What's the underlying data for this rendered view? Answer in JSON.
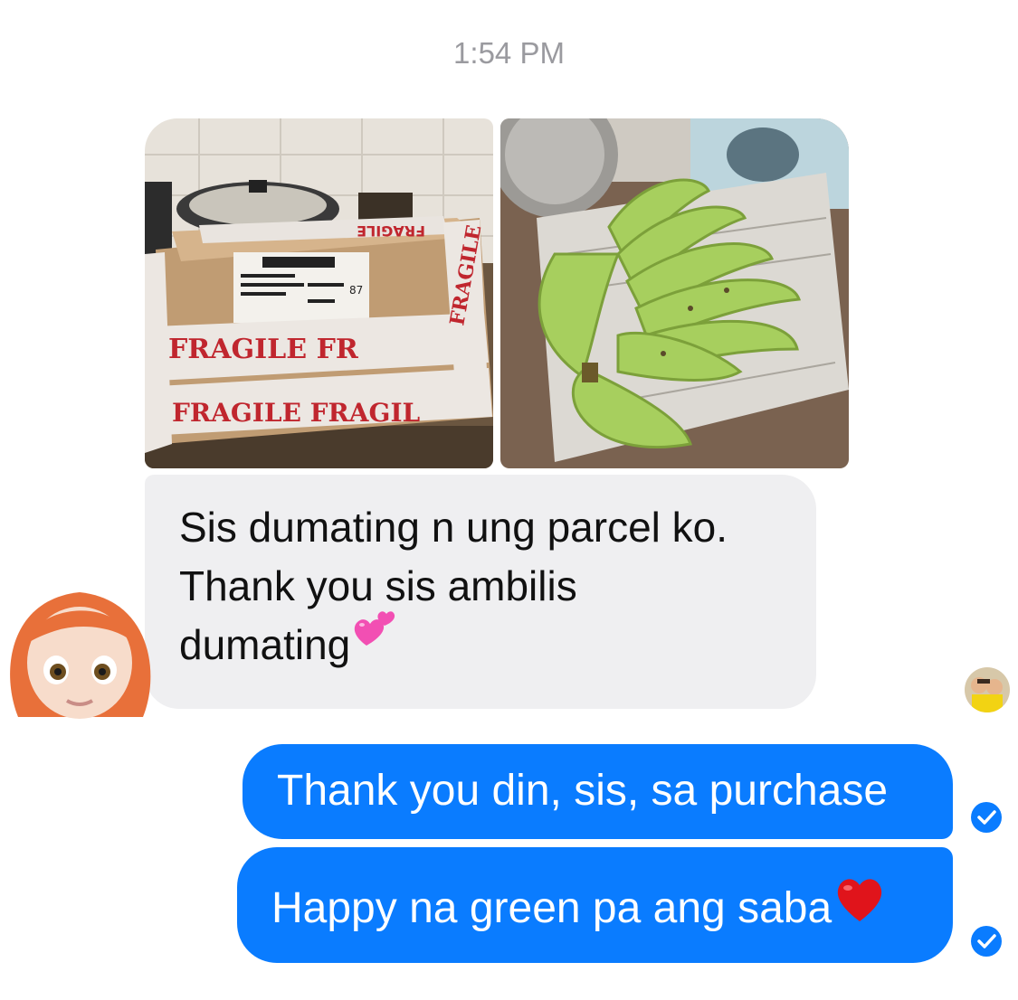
{
  "header": {
    "timestamp": "1:54 PM"
  },
  "attachments": [
    {
      "name": "parcel-photo",
      "tape_text": "FRAGILE"
    },
    {
      "name": "banana-photo"
    }
  ],
  "incoming": {
    "lines": [
      "Sis dumating n ung parcel ko.",
      "Thank you sis ambilis",
      "dumating"
    ],
    "emoji": "pink-hearts-icon"
  },
  "outgoing": [
    {
      "text": "Thank you din, sis, sa purchase",
      "status": "delivered"
    },
    {
      "text": "Happy na green pa ang saba",
      "emoji": "red-heart-icon",
      "status": "delivered"
    }
  ],
  "colors": {
    "outgoing_bubble": "#0a7cff",
    "incoming_bubble": "#efeff1",
    "timestamp": "#9a9a9f"
  }
}
